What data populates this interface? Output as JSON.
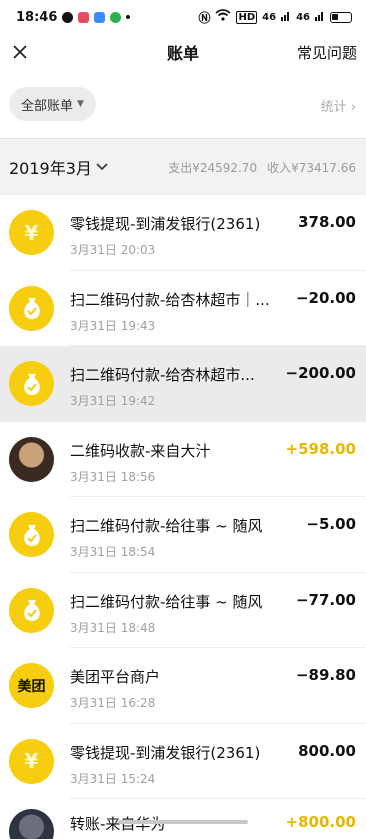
{
  "status_bar": {
    "time": "18:46",
    "net_label": "HD",
    "signal1": "46",
    "signal2": "46"
  },
  "nav": {
    "title": "账单",
    "faq": "常见问题",
    "close_icon": "close-icon"
  },
  "filter": {
    "chip_label": "全部账单",
    "stats_label": "统计 ›"
  },
  "month": {
    "label": "2019年3月",
    "expense": "支出¥24592.70",
    "income": "收入¥73417.66"
  },
  "transactions": [
    {
      "title": "零钱提现-到浦发银行(2361)",
      "time": "3月31日 20:03",
      "amount": "378.00",
      "icon": "yuan-icon",
      "type": "normal"
    },
    {
      "title": "扫二维码付款-给杏林超市｜...",
      "time": "3月31日 19:43",
      "amount": "−20.00",
      "icon": "money-bag-icon",
      "type": "normal"
    },
    {
      "title": "扫二维码付款-给杏林超市...",
      "time": "3月31日 19:42",
      "amount": "−200.00",
      "icon": "money-bag-icon",
      "type": "highlight"
    },
    {
      "title": "二维码收款-来自大汁",
      "time": "3月31日 18:56",
      "amount": "+598.00",
      "icon": "user-photo",
      "type": "income"
    },
    {
      "title": "扫二维码付款-给往事 ~ 随风",
      "time": "3月31日 18:54",
      "amount": "−5.00",
      "icon": "money-bag-icon",
      "type": "normal"
    },
    {
      "title": "扫二维码付款-给往事 ~ 随风",
      "time": "3月31日 18:48",
      "amount": "−77.00",
      "icon": "money-bag-icon",
      "type": "normal"
    },
    {
      "title": "美团平台商户",
      "time": "3月31日 16:28",
      "amount": "−89.80",
      "icon": "meituan-logo",
      "type": "normal",
      "logo_text": "美团"
    },
    {
      "title": "零钱提现-到浦发银行(2361)",
      "time": "3月31日 15:24",
      "amount": "800.00",
      "icon": "yuan-icon",
      "type": "normal"
    }
  ],
  "partial": {
    "title": "转账-来自华为",
    "amount": "+800.00"
  },
  "colors": {
    "brand_yellow": "#f7cd0f",
    "income": "#e8b800"
  }
}
